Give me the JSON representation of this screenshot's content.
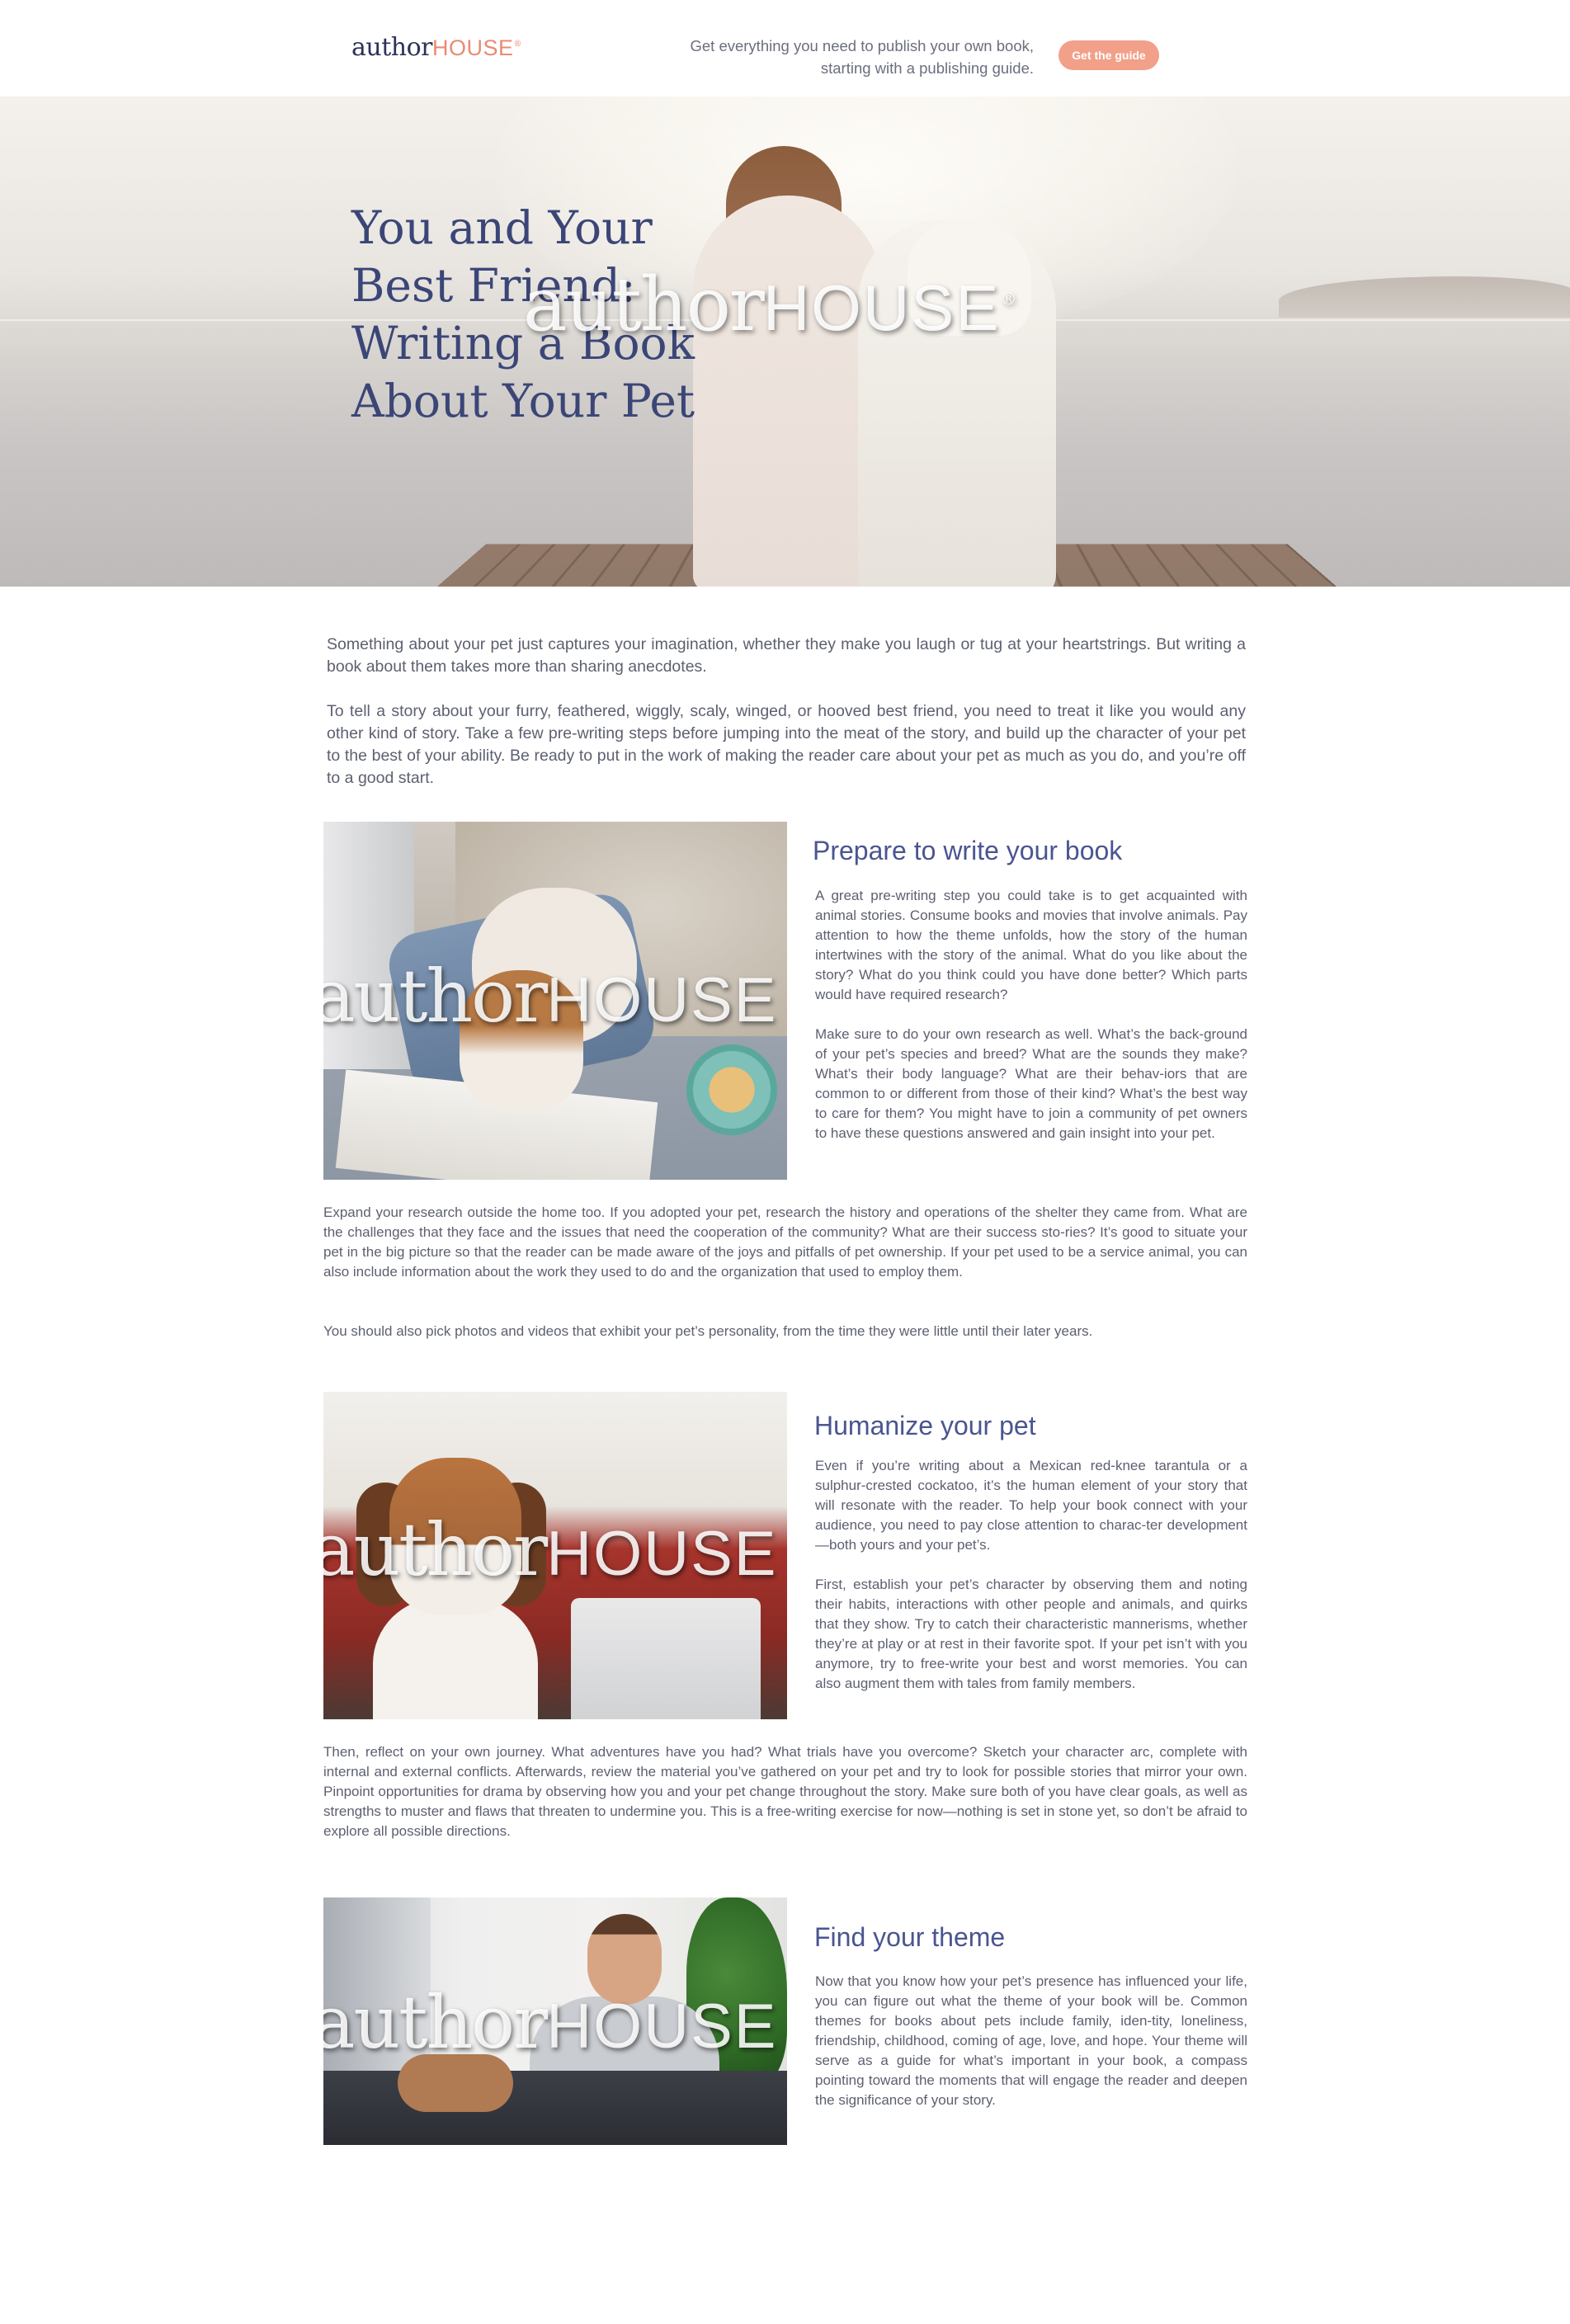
{
  "header": {
    "logo": {
      "author": "author",
      "house": "HOUSE",
      "reg": "®"
    },
    "tagline_line1": "Get everything you need to publish your own book,",
    "tagline_line2": "starting with a publishing guide.",
    "cta_label": "Get the guide"
  },
  "hero": {
    "title_lines": [
      "You and Your",
      "Best Friend:",
      "Writing a Book",
      "About Your Pet"
    ],
    "watermark": {
      "author": "author",
      "house": "HOUSE",
      "reg": "®"
    }
  },
  "intro": [
    "Something about your pet just captures your imagination, whether they make you laugh or tug at your heartstrings. But writing a book about them takes more than sharing anecdotes.",
    "To tell a story about your furry, feathered, wiggly, scaly, winged, or hooved best friend, you need to treat it like you would any other kind of story. Take a few pre-writing steps before jumping into the meat of the story, and build up the character of your pet to the best of your ability. Be ready to put in the work of making the reader care about your pet as much as you do, and you’re off to a good start."
  ],
  "sections": [
    {
      "title": "Prepare to write your book",
      "side_paragraphs": [
        "A great pre-writing step you could take is to get acquainted with animal stories. Consume books and movies that involve animals. Pay attention to how the theme unfolds, how the story of the human intertwines with the story of the animal. What do you like about the story? What do you think could you have done better? Which parts would have required research?",
        "Make sure to do your own research as well. What’s the back-ground of your pet’s species and breed? What are the sounds they make? What’s their body language? What are their behav-iors that are common to or different from those of their kind? What’s the best way to care for them? You might have to join a community of pet owners to have these questions answered and gain insight into your pet."
      ],
      "full_paragraphs": [
        "Expand your research outside the home too. If you adopted your pet, research the history and operations of the shelter they came from. What are the challenges that they face and the issues that need the cooperation of the community? What are their success sto-ries? It’s good to situate your pet in the big picture so that the reader can be made aware of the joys and pitfalls of pet ownership. If your pet used to be a service animal, you can also include information about the work they used to do and the organization that used to employ them.",
        "You should also pick photos and videos that exhibit your pet’s personality, from the time they were little until their later years."
      ]
    },
    {
      "title": "Humanize your pet",
      "side_paragraphs": [
        "Even if you’re writing about a Mexican red-knee tarantula or a sulphur-crested cockatoo, it’s the human element of your story that will resonate with the reader. To help your book connect with your audience, you need to pay close attention to charac-ter development—both yours and your pet’s.",
        "First, establish your pet’s character by observing them and noting their habits, interactions with other people and animals, and quirks that they show. Try to catch their characteristic mannerisms, whether they’re at play or at rest in their favorite spot. If your pet isn’t with you anymore, try to free-write your best and worst memories. You can also augment them with tales from family members."
      ],
      "full_paragraphs": [
        "Then, reflect on your own journey. What adventures have you had? What trials have you overcome? Sketch your character arc, complete with internal and external conflicts. Afterwards, review the material you’ve gathered on your pet and try to look for possible stories that mirror your own. Pinpoint opportunities for drama by observing how you and your pet change throughout the story. Make sure both of you have clear goals, as well as strengths to muster and flaws that threaten to undermine you. This is a free-writing exercise for now—nothing is set in stone yet, so don’t be afraid to explore all possible directions."
      ]
    },
    {
      "title": "Find your theme",
      "side_paragraphs": [
        "Now that you know how your pet’s presence has influenced your life, you can figure out what the theme of your book will be. Common themes for books about pets include family, iden-tity, loneliness, friendship, childhood, coming of age, love, and hope. Your theme will serve as a guide for what’s important in your book, a compass pointing toward the moments that will engage the reader and deepen the significance of your story."
      ]
    }
  ]
}
